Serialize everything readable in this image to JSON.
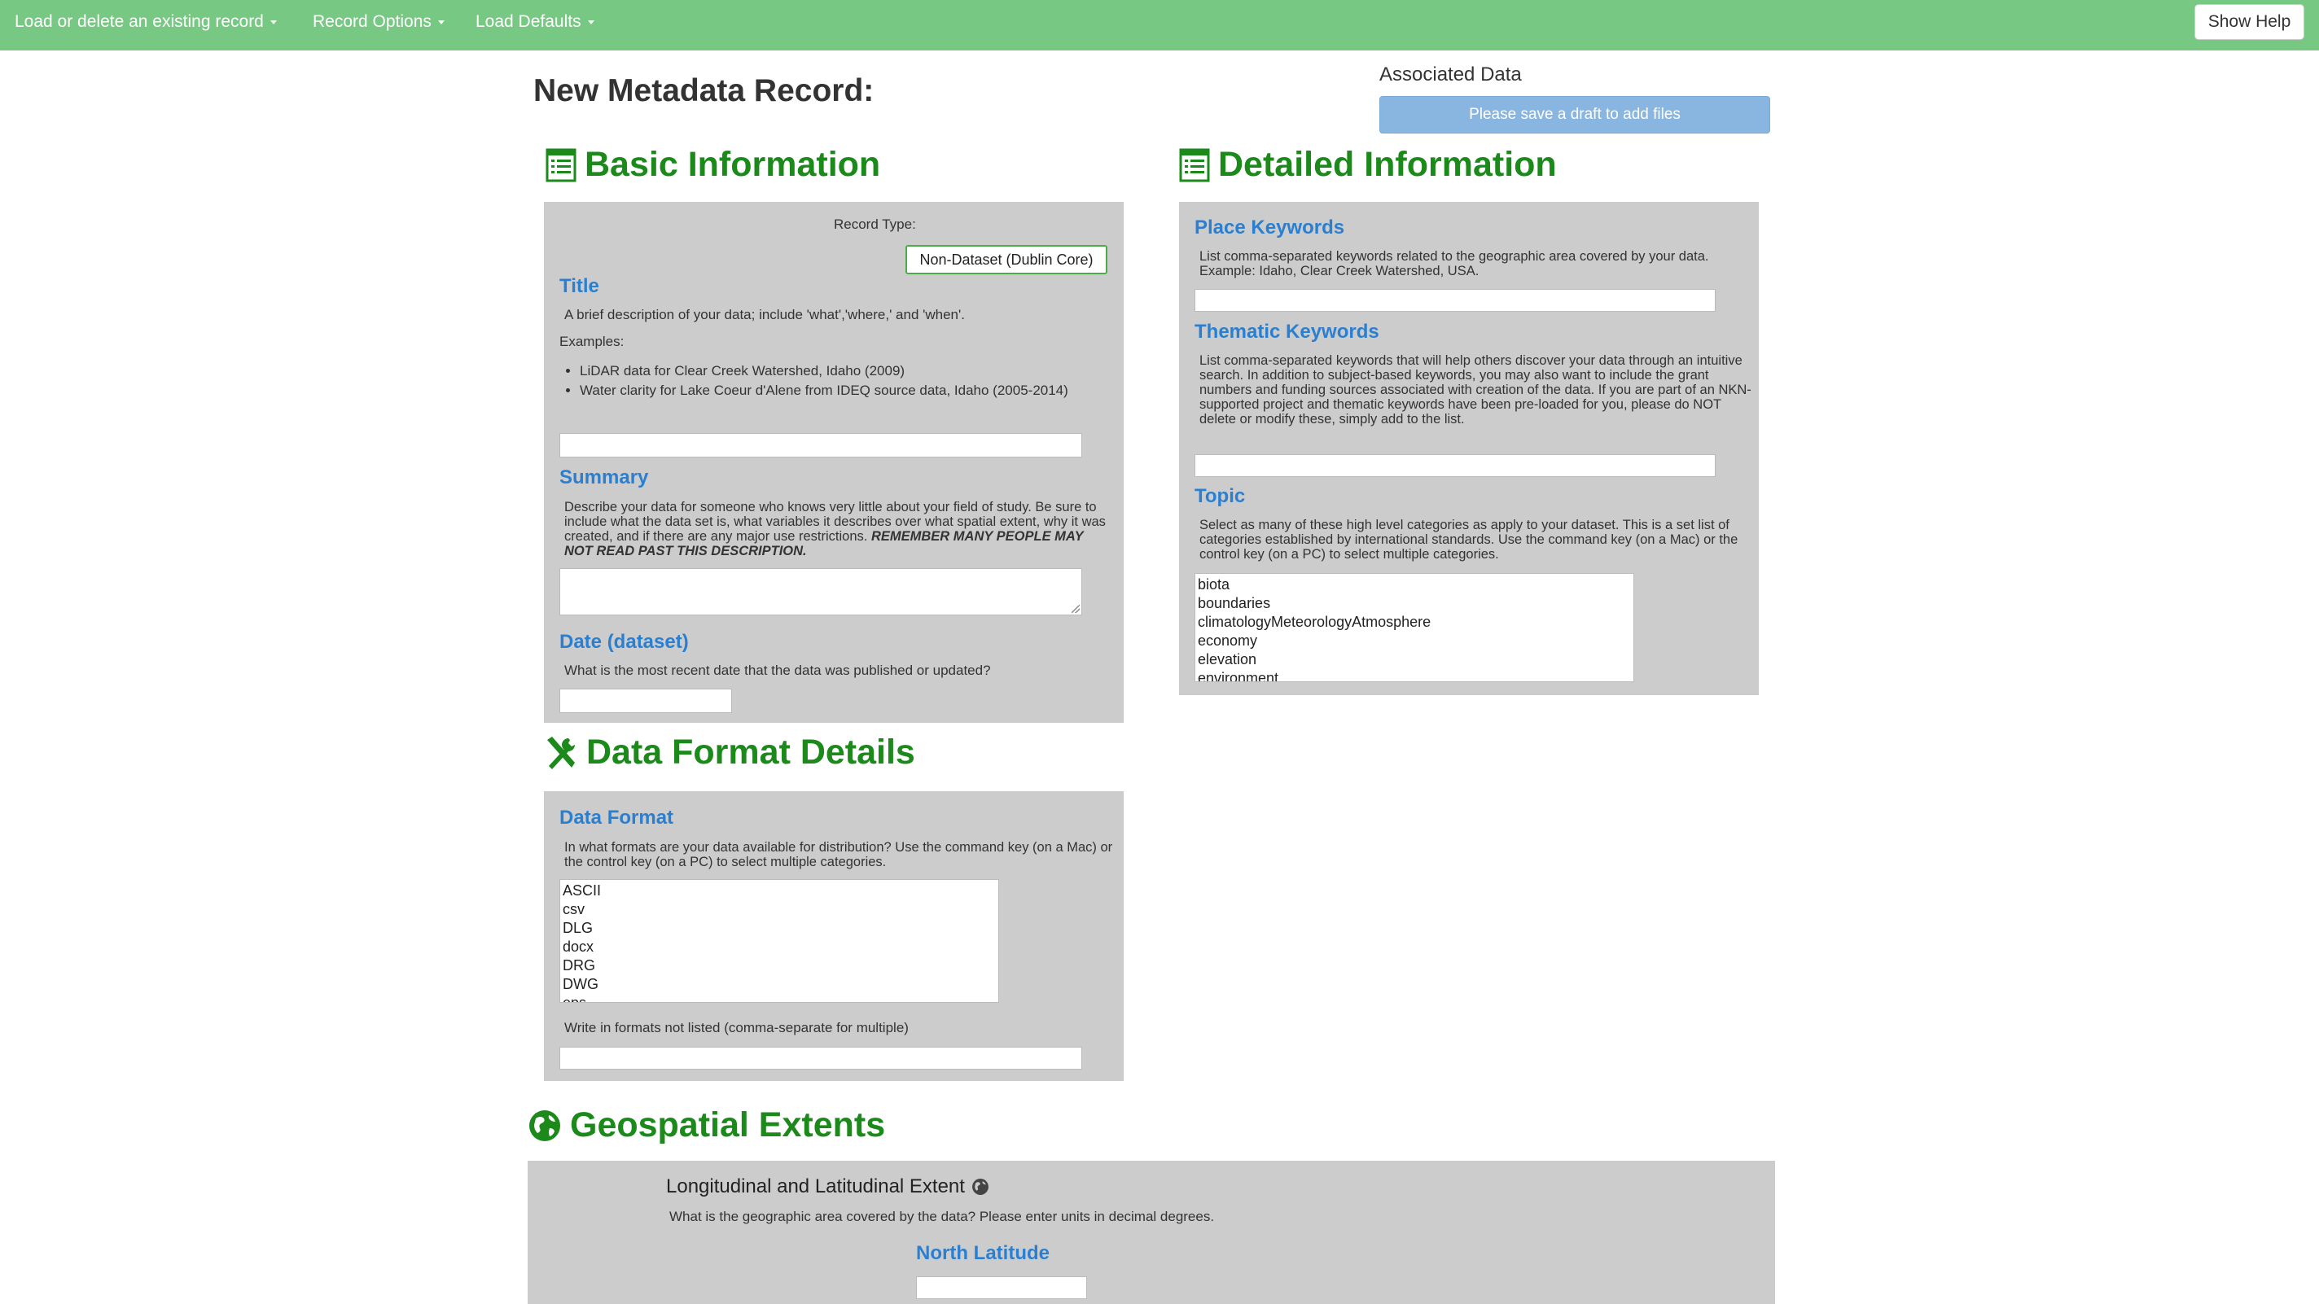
{
  "navbar": {
    "items": [
      {
        "label": "Load or delete an existing record"
      },
      {
        "label": "Record Options"
      },
      {
        "label": "Load Defaults"
      }
    ],
    "show_help": "Show Help"
  },
  "page_title": "New Metadata Record:",
  "associated_data": {
    "label": "Associated Data",
    "button": "Please save a draft to add files"
  },
  "basic_information": {
    "title": "Basic Information",
    "record_type": {
      "label": "Record Type:",
      "value": "Non-Dataset (Dublin Core)"
    },
    "title_field": {
      "label": "Title",
      "help": "A brief description of your data; include 'what','where,' and 'when'.",
      "examples_label": "Examples:",
      "examples": [
        "LiDAR data for Clear Creek Watershed, Idaho (2009)",
        "Water clarity for Lake Coeur d'Alene from IDEQ source data, Idaho (2005-2014)"
      ],
      "value": ""
    },
    "summary": {
      "label": "Summary",
      "help": "Describe your data for someone who knows very little about your field of study. Be sure to include what the data set is, what variables it describes over what spatial extent, why it was created, and if there are any major use restrictions.",
      "help_emphasis": "REMEMBER MANY PEOPLE MAY NOT READ PAST THIS DESCRIPTION.",
      "value": ""
    },
    "date": {
      "label": "Date (dataset)",
      "help": "What is the most recent date that the data was published or updated?",
      "value": ""
    }
  },
  "data_format_details": {
    "title": "Data Format Details",
    "data_format": {
      "label": "Data Format",
      "help": "In what formats are your data available for distribution? Use the command key (on a Mac) or the control key (on a PC) to select multiple categories.",
      "options": [
        "ASCII",
        "csv",
        "DLG",
        "docx",
        "DRG",
        "DWG",
        "eps"
      ],
      "write_in_label": "Write in formats not listed (comma-separate for multiple)",
      "write_in_value": ""
    }
  },
  "detailed_information": {
    "title": "Detailed Information",
    "place_keywords": {
      "label": "Place Keywords",
      "help": "List comma-separated keywords related to the geographic area covered by your data. Example: Idaho, Clear Creek Watershed, USA.",
      "value": ""
    },
    "thematic_keywords": {
      "label": "Thematic Keywords",
      "help": "List comma-separated keywords that will help others discover your data through an intuitive search. In addition to subject-based keywords, you may also want to include the grant numbers and funding sources associated with creation of the data. If you are part of an NKN-supported project and thematic keywords have been pre-loaded for you, please do NOT delete or modify these, simply add to the list.",
      "value": ""
    },
    "topic": {
      "label": "Topic",
      "help": "Select as many of these high level categories as apply to your dataset. This is a set list of categories established by international standards. Use the command key (on a Mac) or the control key (on a PC) to select multiple categories.",
      "options": [
        "biota",
        "boundaries",
        "climatologyMeteorologyAtmosphere",
        "economy",
        "elevation",
        "environment"
      ]
    }
  },
  "geospatial_extents": {
    "title": "Geospatial Extents",
    "lon_lat_label": "Longitudinal and Latitudinal Extent",
    "help": "What is the geographic area covered by the data? Please enter units in decimal degrees.",
    "north_latitude": {
      "label": "North Latitude",
      "value": ""
    }
  },
  "colors": {
    "navbar": "#77c883",
    "section_green": "#1b8a1b",
    "field_blue": "#2a7fd0",
    "panel_gray": "#cccccc",
    "disabled_button": "#88b6e0"
  }
}
